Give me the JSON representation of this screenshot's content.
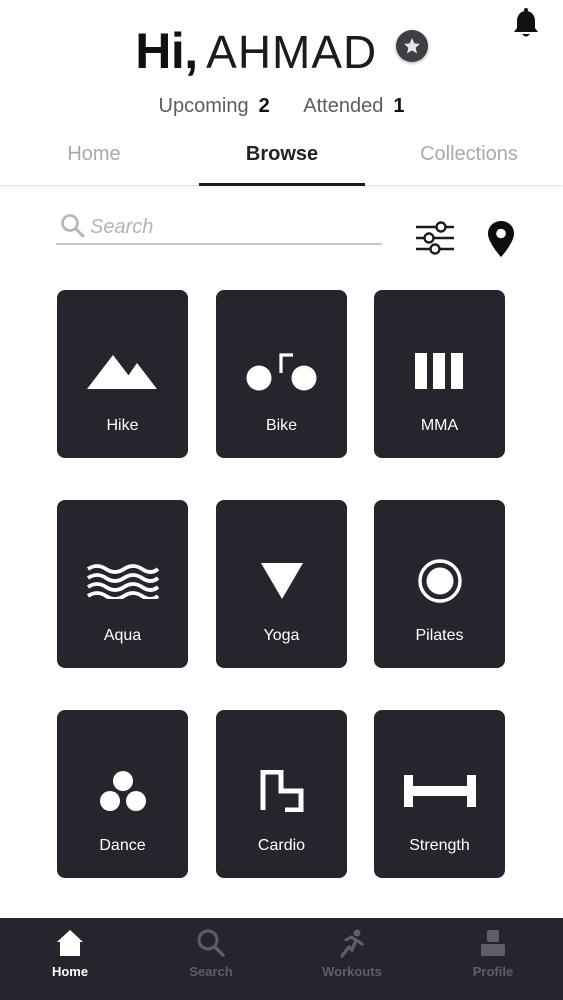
{
  "header": {
    "greeting_prefix": "Hi,",
    "user_name": "AHMAD"
  },
  "stats": {
    "upcoming_label": "Upcoming",
    "upcoming_count": "2",
    "attended_label": "Attended",
    "attended_count": "1"
  },
  "tabs": [
    {
      "label": "Home",
      "active": false
    },
    {
      "label": "Browse",
      "active": true
    },
    {
      "label": "Collections",
      "active": false
    }
  ],
  "search": {
    "placeholder": "Search",
    "value": ""
  },
  "categories": [
    {
      "label": "Hike",
      "icon": "mountain-icon"
    },
    {
      "label": "Bike",
      "icon": "bike-icon"
    },
    {
      "label": "MMA",
      "icon": "mma-icon"
    },
    {
      "label": "Aqua",
      "icon": "waves-icon"
    },
    {
      "label": "Yoga",
      "icon": "triangle-icon"
    },
    {
      "label": "Pilates",
      "icon": "ring-icon"
    },
    {
      "label": "Dance",
      "icon": "dots-icon"
    },
    {
      "label": "Cardio",
      "icon": "steps-icon"
    },
    {
      "label": "Strength",
      "icon": "dumbbell-icon"
    }
  ],
  "bottom_nav": [
    {
      "label": "Home",
      "icon": "home-icon",
      "active": true
    },
    {
      "label": "Search",
      "icon": "search-icon",
      "active": false
    },
    {
      "label": "Workouts",
      "icon": "runner-icon",
      "active": false
    },
    {
      "label": "Profile",
      "icon": "person-icon",
      "active": false
    }
  ],
  "colors": {
    "tile_background": "#24252d",
    "nav_background": "#24252d",
    "nav_inactive": "#5d5e66",
    "text_primary": "#1b1c22",
    "tab_inactive": "#a9a9ae"
  }
}
